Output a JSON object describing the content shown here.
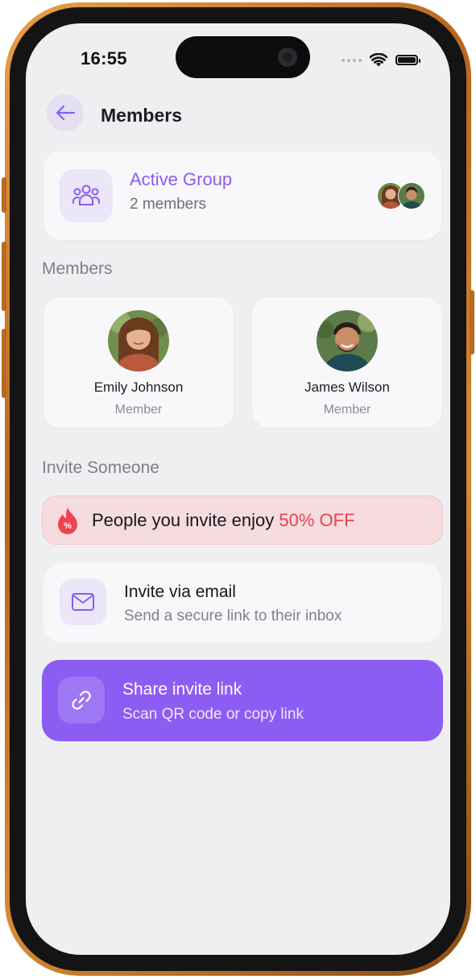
{
  "status_bar": {
    "time": "16:55"
  },
  "header": {
    "title": "Members"
  },
  "group": {
    "name": "Active Group",
    "member_count": "2 members"
  },
  "members_section": {
    "label": "Members",
    "members": [
      {
        "name": "Emily Johnson",
        "role": "Member"
      },
      {
        "name": "James Wilson",
        "role": "Member"
      }
    ]
  },
  "invite_section": {
    "label": "Invite Someone",
    "promo": {
      "text": "People you invite enjoy ",
      "highlight": "50% OFF"
    },
    "email_option": {
      "title": "Invite via email",
      "subtitle": "Send a secure link to their inbox"
    },
    "link_option": {
      "title": "Share invite link",
      "subtitle": "Scan QR code or copy link"
    }
  },
  "icons": {
    "back": "arrow-left-icon",
    "group": "users-group-icon",
    "promo": "fire-percent-icon",
    "email": "mail-icon",
    "link": "link-icon"
  },
  "colors": {
    "accent": "#8c5df2",
    "accent_light": "#ebe6f8",
    "promo_bg": "#f4dcdf",
    "promo_highlight": "#ef4150",
    "background": "#efeff2",
    "card": "#f8f8fa",
    "frame": "#c9782a"
  }
}
